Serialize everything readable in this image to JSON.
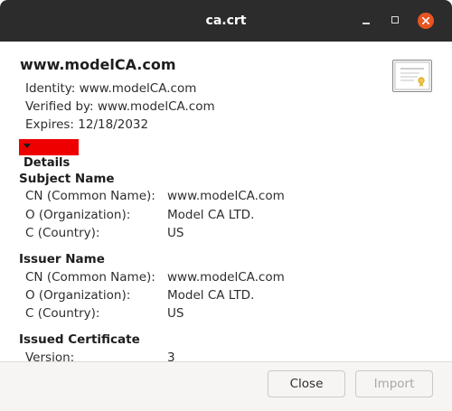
{
  "window": {
    "title": "ca.crt"
  },
  "certificate": {
    "name": "www.modelCA.com",
    "identity_label": "Identity: www.modelCA.com",
    "verified_label": "Verified by: www.modelCA.com",
    "expires_label": "Expires: 12/18/2032",
    "icon": "certificate-icon"
  },
  "details": {
    "toggle_label": "Details",
    "expanded": true
  },
  "subject": {
    "title": "Subject Name",
    "rows": [
      {
        "label": "CN (Common Name):",
        "value": "www.modelCA.com"
      },
      {
        "label": "O (Organization):",
        "value": "Model CA LTD."
      },
      {
        "label": "C (Country):",
        "value": "US"
      }
    ]
  },
  "issuer": {
    "title": "Issuer Name",
    "rows": [
      {
        "label": "CN (Common Name):",
        "value": "www.modelCA.com"
      },
      {
        "label": "O (Organization):",
        "value": "Model CA LTD."
      },
      {
        "label": "C (Country):",
        "value": "US"
      }
    ]
  },
  "issued": {
    "title": "Issued Certificate",
    "rows": [
      {
        "label": "Version:",
        "value": "3"
      }
    ]
  },
  "buttons": {
    "close_label": "Close",
    "import_label": "Import"
  }
}
